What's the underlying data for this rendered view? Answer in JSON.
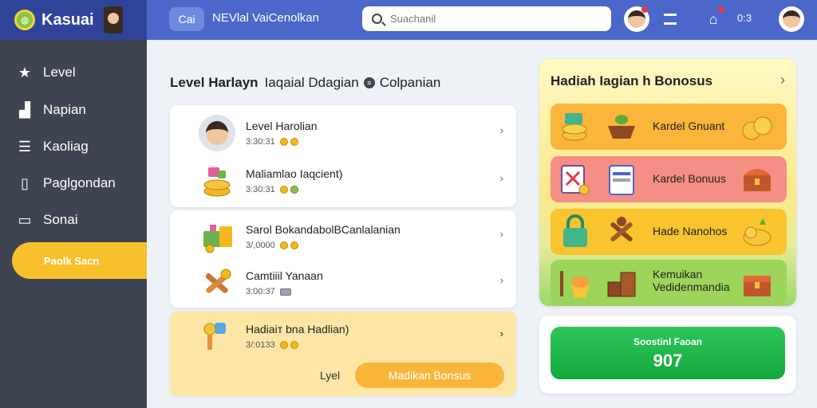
{
  "app": {
    "name": "Kasuai"
  },
  "header": {
    "chip_label": "Cai",
    "title": "NEVlal VaiCenolkan",
    "search_placeholder": "Suachanil",
    "counter": "0:3"
  },
  "sidebar": {
    "items": [
      {
        "label": "Level",
        "icon": "star-icon"
      },
      {
        "label": "Napian",
        "icon": "stats-icon"
      },
      {
        "label": "Kaoliag",
        "icon": "list-icon"
      },
      {
        "label": "Paglgondan",
        "icon": "book-icon"
      },
      {
        "label": "Sonai",
        "icon": "page-icon"
      }
    ],
    "cta_label": "Paolk Sacn"
  },
  "main": {
    "title_part1": "Level Harlayn",
    "title_part2": "Iaqaial Ddagian",
    "title_part3": "Colpanian",
    "groups": [
      {
        "rows": [
          {
            "title": "Level Harolian",
            "meta": "3:30:31",
            "coins": "yy",
            "icon": "avatar"
          },
          {
            "title": "Maliamlao Iaqcient)",
            "meta": "3:30:31",
            "coins": "yg",
            "icon": "coins"
          }
        ]
      },
      {
        "rows": [
          {
            "title": "Sarol BokandabolВCanlalanian",
            "meta": "3/,0000",
            "coins": "yy",
            "icon": "gift"
          },
          {
            "title": "Camtiiil Yanaan",
            "meta": "3:00:37",
            "coins": "t",
            "icon": "tools"
          }
        ]
      },
      {
        "rows": [
          {
            "title": "Hadiaiт bna Hadlian)",
            "meta": "3/:0133",
            "coins": "yy",
            "icon": "key"
          }
        ],
        "footer_label": "Lyel",
        "button_label": "Madikan Bonsus"
      }
    ]
  },
  "rewards": {
    "title": "Hadiah Iagian h Bonosus",
    "items": [
      {
        "label": "Kardel Gnuant",
        "color": "#fbb53a"
      },
      {
        "label": "Kardel Bonuus",
        "color": "#f58e84"
      },
      {
        "label": "Hade Nanohos",
        "color": "#f9c42e"
      },
      {
        "label": "Kemuikan Vedidenmandia",
        "color": "#9dd45a"
      }
    ]
  },
  "total": {
    "label": "Soostinl Faoan",
    "value": "907"
  }
}
